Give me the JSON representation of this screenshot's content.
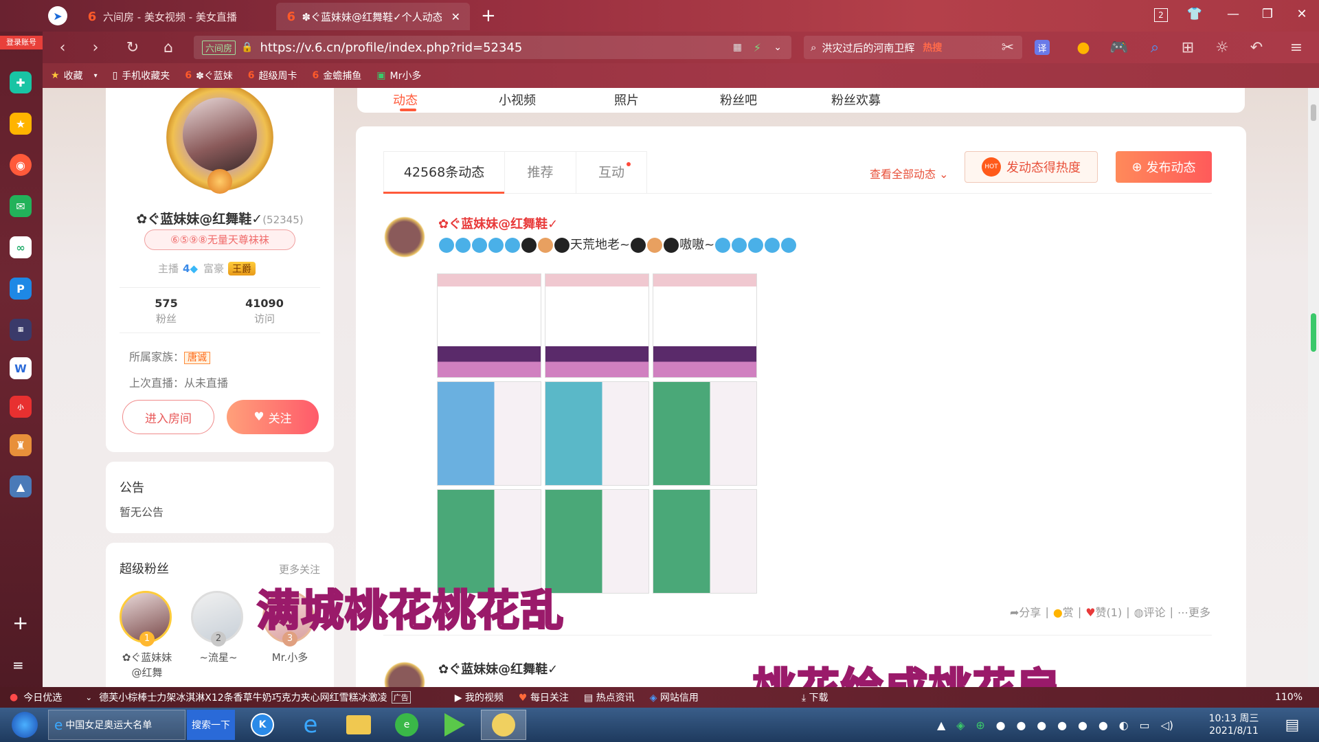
{
  "browser": {
    "tabs": [
      {
        "label": "六间房 - 美女视频 - 美女直播"
      },
      {
        "label": "✽ぐ蓝妹妹@红舞鞋✓个人动态"
      }
    ],
    "tab_count_badge": "2",
    "url_security_label": "六间房",
    "url": "https://v.6.cn/profile/index.php?rid=52345",
    "search_text": "洪灾过后的河南卫辉",
    "search_hot": "热搜",
    "translate_label": "译",
    "login_label": "登录账号",
    "zoom": "110%"
  },
  "bookmarks": [
    {
      "label": "收藏",
      "icon": "star-icon"
    },
    {
      "label": "手机收藏夹",
      "icon": "phone-icon"
    },
    {
      "label": "✽ぐ蓝妹",
      "icon": "six-icon"
    },
    {
      "label": "超级周卡",
      "icon": "six-icon"
    },
    {
      "label": "金蟾捕鱼",
      "icon": "six-icon"
    },
    {
      "label": "Mr小多",
      "icon": "six-icon"
    }
  ],
  "top_tabs": [
    "动态",
    "小视频",
    "照片",
    "粉丝吧",
    "粉丝欢募"
  ],
  "profile": {
    "name": "✿ぐ蓝妹妹@红舞鞋✓",
    "rid": "(52345)",
    "badge": "⑥⑤⑨⑧无量天尊袜袜",
    "host_label": "主播",
    "host_level": "4",
    "rich_label": "富豪",
    "rich_title": "王爵",
    "fans_count": "575",
    "fans_label": "粉丝",
    "visits_count": "41090",
    "visits_label": "访问",
    "family_label": "所属家族：",
    "family_name": "唐诚",
    "last_live_label": "上次直播：从未直播",
    "enter_room": "进入房间",
    "follow": "关注"
  },
  "notice": {
    "title": "公告",
    "content": "暂无公告"
  },
  "super_fans": {
    "title": "超级粉丝",
    "more": "更多关注",
    "fans": [
      {
        "rank": "1",
        "name": "✿ぐ蓝妹妹@红舞"
      },
      {
        "rank": "2",
        "name": "~流星~"
      },
      {
        "rank": "3",
        "name": "Mr.小多"
      }
    ]
  },
  "feed": {
    "tabs": [
      "42568条动态",
      "推荐",
      "互动"
    ],
    "view_all": "查看全部动态",
    "heat_button": "发动态得热度",
    "post_button": "发布动态",
    "posts": [
      {
        "author": "✿ぐ蓝妹妹@红舞鞋✓",
        "text_parts": [
          "天荒地老~",
          "嗷嗷~"
        ],
        "actions": [
          "分享",
          "赏",
          "赞(1)",
          "评论",
          "更多"
        ]
      },
      {
        "author": "✿ぐ蓝妹妹@红舞鞋✓"
      }
    ]
  },
  "overlays": {
    "line1": "满城桃花桃花乱",
    "line2": "桃花绘成桃花扇"
  },
  "statusbar": {
    "today": "今日优选",
    "ad": "德芙小棕棒士力架冰淇淋X12条香草牛奶巧克力夹心网红雪糕冰激凌",
    "ad_tag": "广告",
    "items": [
      "我的视频",
      "每日关注",
      "热点资讯",
      "网站信用",
      "下载"
    ]
  },
  "taskbar": {
    "ie_item": "中国女足奥运大名单",
    "search_btn": "搜索一下",
    "time": "10:13 周三",
    "date": "2021/8/11"
  },
  "colors": {
    "accent": "#ff6a4a",
    "brand_pink": "#ff5a6a",
    "title_bar": "#9a3040"
  }
}
